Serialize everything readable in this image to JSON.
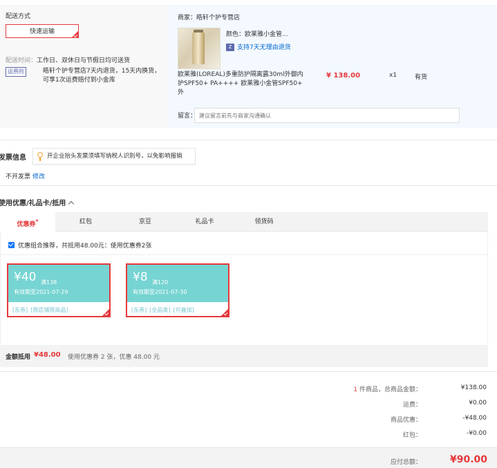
{
  "shipping": {
    "title": "配送方式",
    "method": "快速运输",
    "time_label": "配送时间：",
    "time_value": "工作日、双休日与节假日均可送货",
    "freight_badge": "运费险",
    "freight_text": "皓轩个护专营店7天内退货，15天内换货，可享1次运费赔付到小金库"
  },
  "product": {
    "shop": "商家：皓轩个护专营店",
    "color": "颜色：欧莱雅小金管...",
    "return_badge": "Z",
    "return_text": "支持7天无理由退货",
    "name": "欧莱雅(LOREAL)多重防护隔离露30ml外御内护SPF50+ PA++++ 欧莱雅小金管SPF50+ 外",
    "price": "¥ 138.00",
    "qty": "x1",
    "stock": "有货",
    "remark_label": "留言：",
    "remark_placeholder": "建议留言前先与商家沟通确认"
  },
  "invoice": {
    "title": "发票信息",
    "tip": "开企业抬头发票须填写纳税人识别号，以免影响报销",
    "status": "不开发票",
    "edit": "修改"
  },
  "coupons": {
    "title": "使用优惠/礼品卡/抵用",
    "tabs": [
      {
        "label": "优惠券",
        "mark": "*"
      },
      {
        "label": "红包"
      },
      {
        "label": "京豆"
      },
      {
        "label": "礼品卡"
      },
      {
        "label": "领货码"
      }
    ],
    "combo_text": "优惠组合推荐，共抵用48.00元：使用优惠券2张",
    "items": [
      {
        "amount": "¥40",
        "condition": "满138",
        "expiry": "有效期至2021-07-29",
        "tags": [
          "[东券]",
          "[限店铺限商品]"
        ]
      },
      {
        "amount": "¥8",
        "condition": "满120",
        "expiry": "有效期至2021-07-30",
        "tags": [
          "[东券]",
          "[全品类]",
          "[可叠加]"
        ]
      }
    ],
    "discount_label": "金额抵用",
    "discount_amount": "¥48.00",
    "discount_desc": "使用优惠券 2 张，优惠 48.00 元"
  },
  "summary": {
    "count": "1",
    "count_suffix": " 件商品，总商品金额：",
    "goods_total": "¥138.00",
    "shipping_label": "运费：",
    "shipping_value": "¥0.00",
    "discount_label": "商品优惠：",
    "discount_value": "-¥48.00",
    "redpacket_label": "红包：",
    "redpacket_value": "-¥0.00",
    "total_label": "应付总额：",
    "total_value": "¥90.00"
  },
  "colors": {
    "accent": "#e4393c",
    "coupon": "#76d4d2",
    "link": "#0066cc"
  }
}
